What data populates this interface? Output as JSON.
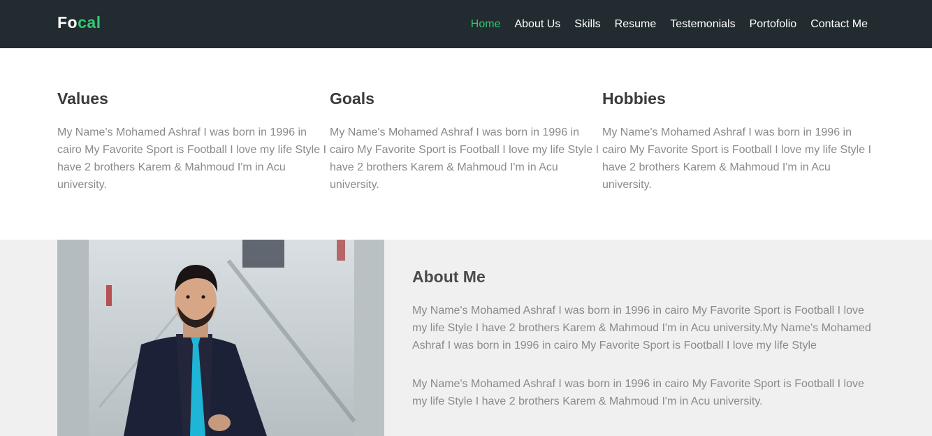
{
  "brand": {
    "part1": "Fo",
    "part2": "cal"
  },
  "nav": {
    "items": [
      {
        "label": "Home",
        "active": true
      },
      {
        "label": "About Us"
      },
      {
        "label": "Skills"
      },
      {
        "label": "Resume"
      },
      {
        "label": "Testemonials"
      },
      {
        "label": "Portofolio"
      },
      {
        "label": "Contact Me"
      }
    ]
  },
  "features": [
    {
      "title": "Values",
      "text": "My Name's Mohamed Ashraf I was born in 1996 in cairo My Favorite Sport is Football I love my life Style I have 2 brothers Karem & Mahmoud I'm in Acu university."
    },
    {
      "title": "Goals",
      "text": "My Name's Mohamed Ashraf I was born in 1996 in cairo My Favorite Sport is Football I love my life Style I have 2 brothers Karem & Mahmoud I'm in Acu university."
    },
    {
      "title": "Hobbies",
      "text": "My Name's Mohamed Ashraf I was born in 1996 in cairo My Favorite Sport is Football I love my life Style I have 2 brothers Karem & Mahmoud I'm in Acu university."
    }
  ],
  "about": {
    "title": "About Me",
    "paragraphs": [
      "My Name's Mohamed Ashraf I was born in 1996 in cairo My Favorite Sport is Football I love my life Style I have 2 brothers Karem & Mahmoud I'm in Acu university.My Name's Mohamed Ashraf I was born in 1996 in cairo My Favorite Sport is Football I love my life Style",
      "My Name's Mohamed Ashraf I was born in 1996 in cairo My Favorite Sport is Football I love my life Style I have 2 brothers Karem & Mahmoud I'm in Acu university."
    ]
  },
  "colors": {
    "nav_bg": "#222b2f",
    "accent": "#2ecc71",
    "about_bg": "#f0f0f0"
  }
}
